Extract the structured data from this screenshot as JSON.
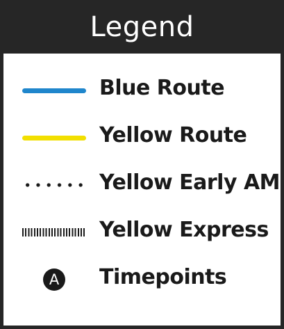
{
  "legend": {
    "title": "Legend",
    "items": [
      {
        "label": "Blue Route",
        "symbol": "solid-line",
        "color": "#1f86cc"
      },
      {
        "label": "Yellow Route",
        "symbol": "solid-line",
        "color": "#f2df00"
      },
      {
        "label": "Yellow Early AM",
        "symbol": "dotted-line",
        "color": "#1a1a1a"
      },
      {
        "label": "Yellow Express",
        "symbol": "dashed-line",
        "color": "#1a1a1a"
      },
      {
        "label": "Timepoints",
        "symbol": "timepoint-circle",
        "marker_text": "A",
        "color": "#1a1a1a"
      }
    ]
  },
  "colors": {
    "header_bg": "#262626",
    "header_text": "#ffffff",
    "body_bg": "#ffffff",
    "text": "#1a1a1a"
  }
}
